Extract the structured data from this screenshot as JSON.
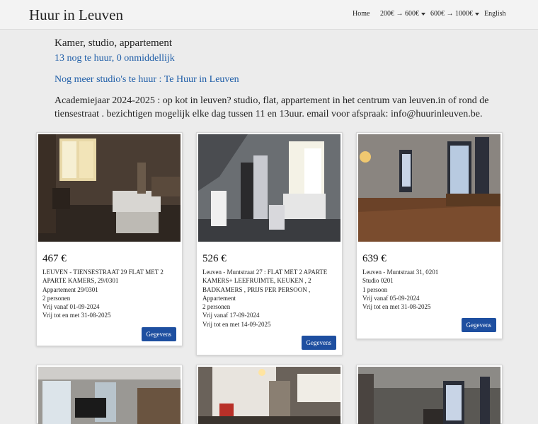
{
  "brand": "Huur in Leuven",
  "nav": {
    "home": "Home",
    "range1": "200€ → 600€",
    "range2": "600€ → 1000€",
    "language": "English"
  },
  "intro": {
    "heading": "Kamer, studio, appartement",
    "count_text": "13  nog te huur,",
    "immediate_text": "0 onmiddellijk",
    "more_link": "Nog meer studio's te huur : Te Huur in Leuven",
    "description": "Academiejaar 2024-2025 : op kot in leuven? studio, flat, appartement in het centrum van leuven.in of rond de tiensestraat . bezichtigen mogelijk elke dag tussen 11 en 13uur. email voor afspraak: info@huurinleuven.be."
  },
  "listings": [
    {
      "price": "467 €",
      "title": "LEUVEN - TIENSESTRAAT 29 FLAT MET 2 APARTE KAMERS, 29/0301",
      "type": "Appartement 29/0301",
      "persons": "2 personen",
      "free_from": "Vrij vanaf 01-09-2024",
      "free_until": "Vrij tot en met 31-08-2025",
      "button": "Gegevens"
    },
    {
      "price": "526 €",
      "title": "Leuven - Muntstraat 27 : FLAT MET 2 APARTE KAMERS+ LEEFRUIMTE, KEUKEN , 2 BADKAMERS , PRIJS PER PERSOON , Appartement",
      "type": "",
      "persons": "2 personen",
      "free_from": "Vrij vanaf 17-09-2024",
      "free_until": "Vrij tot en met 14-09-2025",
      "button": "Gegevens"
    },
    {
      "price": "639 €",
      "title": "Leuven - Muntstraat 31, 0201",
      "type": "Studio 0201",
      "persons": "1 persoon",
      "free_from": "Vrij vanaf 05-09-2024",
      "free_until": "Vrij tot en met 31-08-2025",
      "button": "Gegevens"
    }
  ]
}
